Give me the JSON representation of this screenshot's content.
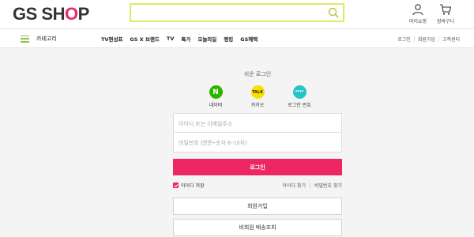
{
  "header": {
    "logo_left": "GS SH",
    "logo_o": "O",
    "logo_right": "P",
    "search": {
      "value": "",
      "placeholder": ""
    },
    "my_shopping": "마이쇼핑",
    "cart": "장바구니"
  },
  "nav": {
    "category": "카테고리",
    "menu": [
      "TV편성표",
      "GS X 브랜드",
      "TV",
      "특가",
      "오늘의딜",
      "랭킹",
      "GS혜택"
    ],
    "right": [
      "로그인",
      "회원가입",
      "고객센터"
    ]
  },
  "login": {
    "title": "쉬운 로그인",
    "sns": [
      {
        "label": "네이버",
        "glyph": "N",
        "color": "#2db400",
        "text_color": "#ffffff"
      },
      {
        "label": "카카오",
        "glyph": "TALK",
        "color": "#f9e000",
        "text_color": "#3a1d1d"
      },
      {
        "label": "로그인 번호",
        "glyph": "****",
        "color": "#25c5c5",
        "text_color": "#ffffff"
      }
    ],
    "id_placeholder": "아이디 또는 이메일주소",
    "pw_placeholder": "비밀번호 (영문+숫자 8~16자)",
    "submit": "로그인",
    "save_id": "아이디 저장",
    "find_id": "아이디 찾기",
    "find_pw": "비밀번호 찾기",
    "join": "회원가입",
    "guest_order": "비회원 배송조회"
  },
  "colors": {
    "brand": "#ee2763",
    "search_border": "#dfe86b",
    "menu_icon": "#8bc34a"
  }
}
